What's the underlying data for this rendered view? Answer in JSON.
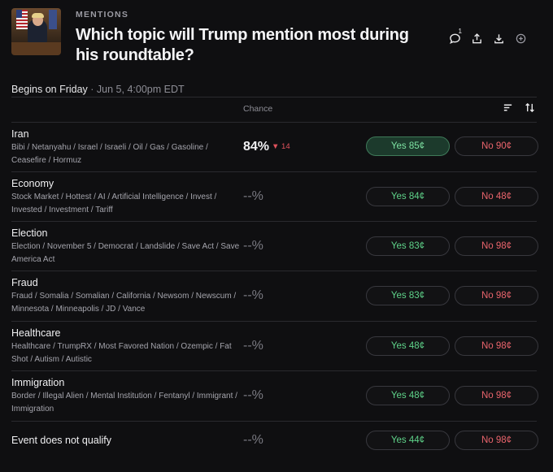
{
  "eyebrow": "MENTIONS",
  "title": "Which topic will Trump mention most during his roundtable?",
  "header_icons": {
    "comments_badge": "1"
  },
  "meta": {
    "begins": "Begins on Friday",
    "sep": " · ",
    "date": "Jun 5, 4:00pm EDT"
  },
  "table": {
    "chance_header": "Chance"
  },
  "rows": [
    {
      "name": "Iran",
      "keywords": "Bibi / Netanyahu / Israel / Israeli / Oil / Gas / Gasoline / Ceasefire / Hormuz",
      "chance": "84%",
      "delta": "▼ 14",
      "yes": "Yes 85¢",
      "no": "No 90¢"
    },
    {
      "name": "Economy",
      "keywords": "Stock Market / Hottest / AI / Artificial Intelligence / Invest / Invested / Investment / Tariff",
      "chance": "--%",
      "delta": "",
      "yes": "Yes 84¢",
      "no": "No 48¢"
    },
    {
      "name": "Election",
      "keywords": "Election / November 5 / Democrat / Landslide / Save Act / Save America Act",
      "chance": "--%",
      "delta": "",
      "yes": "Yes 83¢",
      "no": "No 98¢"
    },
    {
      "name": "Fraud",
      "keywords": "Fraud / Somalia / Somalian / California / Newsom / Newscum / Minnesota / Minneapolis / JD / Vance",
      "chance": "--%",
      "delta": "",
      "yes": "Yes 83¢",
      "no": "No 98¢"
    },
    {
      "name": "Healthcare",
      "keywords": "Healthcare / TrumpRX / Most Favored Nation / Ozempic / Fat Shot / Autism / Autistic",
      "chance": "--%",
      "delta": "",
      "yes": "Yes 48¢",
      "no": "No 98¢"
    },
    {
      "name": "Immigration",
      "keywords": "Border / Illegal Alien / Mental Institution / Fentanyl / Immigrant / Immigration",
      "chance": "--%",
      "delta": "",
      "yes": "Yes 48¢",
      "no": "No 98¢"
    },
    {
      "name": "Event does not qualify",
      "keywords": "",
      "chance": "--%",
      "delta": "",
      "yes": "Yes 44¢",
      "no": "No 98¢"
    }
  ],
  "colors": {
    "yes": "#5fd48a",
    "no": "#e9646c",
    "delta_down": "#e0525c",
    "background": "#0f0f11"
  }
}
